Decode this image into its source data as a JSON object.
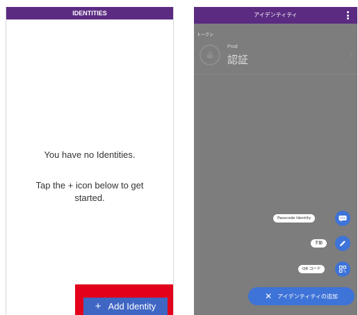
{
  "left": {
    "header_title": "IDENTITIES",
    "empty_title": "You have no Identities.",
    "empty_hint": "Tap the + icon below to get started.",
    "add_button": {
      "icon": "+",
      "label": "Add Identity"
    }
  },
  "right": {
    "header_title": "アイデンティティ",
    "token_section_label": "トークン",
    "token": {
      "issuer": "Prod",
      "name": "認証",
      "chevron": "›"
    },
    "fab_menu": {
      "passcode_label": "Passcode Identity",
      "manual_label": "手動",
      "qr_label": "QR コード",
      "add_label": "アイデンティティの追加",
      "close_icon": "✕"
    }
  },
  "colors": {
    "header": "#5b2b82",
    "accent_blue": "#3e73d8",
    "highlight_red": "#e3001b"
  },
  "icons": [
    "kebab-menu-icon",
    "lock-icon",
    "chevron-right-icon",
    "chat-bubble-icon",
    "pencil-icon",
    "qr-code-icon",
    "close-icon",
    "plus-icon"
  ]
}
